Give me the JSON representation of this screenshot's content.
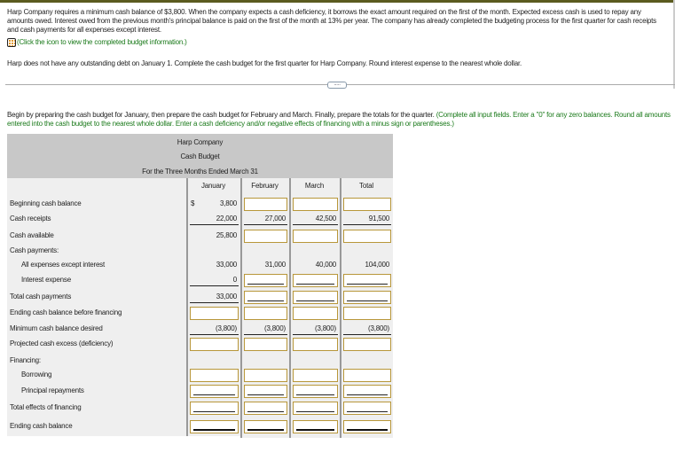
{
  "intro": {
    "paragraph": "Harp Company requires a minimum cash balance of $3,800. When the company expects a cash deficiency, it borrows the exact amount required on the first of the month. Expected excess cash is used to repay any amounts owed. Interest owed from the previous month's principal balance is paid on the first of the month at 13% per year. The company has already completed the budgeting process for the first quarter for cash receipts and cash payments for all expenses except interest.",
    "icon_link": "(Click the icon to view the completed budget information.)",
    "task": "Harp does not have any outstanding debt on January 1. Complete the cash budget for the first quarter for Harp Company. Round interest expense to the nearest whole dollar.",
    "more_button": "....."
  },
  "instructions": {
    "text": "Begin by preparing the cash budget for January, then prepare the cash budget for February and March. Finally, prepare the totals for the quarter.",
    "hint": "(Complete all input fields. Enter a \"0\" for any zero balances. Round all amounts entered into the cash budget to the nearest whole dollar. Enter a cash deficiency and/or negative effects of financing with a minus sign or parentheses.)"
  },
  "table": {
    "company": "Harp Company",
    "title": "Cash Budget",
    "period": "For the Three Months Ended March 31",
    "columns": [
      "January",
      "February",
      "March",
      "Total"
    ],
    "currency": "$",
    "rows": [
      {
        "label": "Beginning cash balance",
        "indent": 0,
        "cells": [
          {
            "t": "v",
            "v": "3,800"
          },
          {
            "t": "i"
          },
          {
            "t": "i"
          },
          {
            "t": "i"
          }
        ]
      },
      {
        "label": "Cash receipts",
        "indent": 0,
        "cells": [
          {
            "t": "v",
            "v": "22,000",
            "ul": true
          },
          {
            "t": "v",
            "v": "27,000",
            "ul": true
          },
          {
            "t": "v",
            "v": "42,500",
            "ul": true
          },
          {
            "t": "v",
            "v": "91,500",
            "ul": true
          }
        ]
      },
      {
        "label": "Cash available",
        "indent": 0,
        "cells": [
          {
            "t": "v",
            "v": "25,800"
          },
          {
            "t": "i"
          },
          {
            "t": "i"
          },
          {
            "t": "i"
          }
        ]
      },
      {
        "label": "Cash payments:",
        "indent": 0,
        "cells": []
      },
      {
        "label": "All expenses except interest",
        "indent": 1,
        "cells": [
          {
            "t": "v",
            "v": "33,000"
          },
          {
            "t": "v",
            "v": "31,000"
          },
          {
            "t": "v",
            "v": "40,000"
          },
          {
            "t": "v",
            "v": "104,000"
          }
        ]
      },
      {
        "label": "Interest expense",
        "indent": 1,
        "cells": [
          {
            "t": "v",
            "v": "0",
            "ul": true
          },
          {
            "t": "iu"
          },
          {
            "t": "iu"
          },
          {
            "t": "iu"
          }
        ]
      },
      {
        "label": "Total cash payments",
        "indent": 0,
        "cells": [
          {
            "t": "v",
            "v": "33,000",
            "ul": true
          },
          {
            "t": "iu"
          },
          {
            "t": "iu"
          },
          {
            "t": "iu"
          }
        ]
      },
      {
        "label": "Ending cash balance before financing",
        "indent": 0,
        "cells": [
          {
            "t": "i"
          },
          {
            "t": "i"
          },
          {
            "t": "i"
          },
          {
            "t": "i"
          }
        ]
      },
      {
        "label": "Minimum cash balance desired",
        "indent": 0,
        "cells": [
          {
            "t": "v",
            "v": "(3,800)",
            "ul": true
          },
          {
            "t": "v",
            "v": "(3,800)",
            "ul": true
          },
          {
            "t": "v",
            "v": "(3,800)",
            "ul": true
          },
          {
            "t": "v",
            "v": "(3,800)",
            "ul": true
          }
        ]
      },
      {
        "label": "Projected cash excess (deficiency)",
        "indent": 0,
        "cells": [
          {
            "t": "i"
          },
          {
            "t": "i"
          },
          {
            "t": "i"
          },
          {
            "t": "i"
          }
        ]
      },
      {
        "label": "Financing:",
        "indent": 0,
        "cells": []
      },
      {
        "label": "Borrowing",
        "indent": 1,
        "cells": [
          {
            "t": "i"
          },
          {
            "t": "i"
          },
          {
            "t": "i"
          },
          {
            "t": "i"
          }
        ]
      },
      {
        "label": "Principal repayments",
        "indent": 1,
        "cells": [
          {
            "t": "iu"
          },
          {
            "t": "iu"
          },
          {
            "t": "iu"
          },
          {
            "t": "iu"
          }
        ]
      },
      {
        "label": "Total effects of financing",
        "indent": 0,
        "cells": [
          {
            "t": "iu"
          },
          {
            "t": "iu"
          },
          {
            "t": "iu"
          },
          {
            "t": "iu"
          }
        ]
      },
      {
        "label": "Ending cash balance",
        "indent": 0,
        "cells": [
          {
            "t": "iuu"
          },
          {
            "t": "iuu"
          },
          {
            "t": "iuu"
          },
          {
            "t": "iuu"
          }
        ]
      }
    ]
  }
}
